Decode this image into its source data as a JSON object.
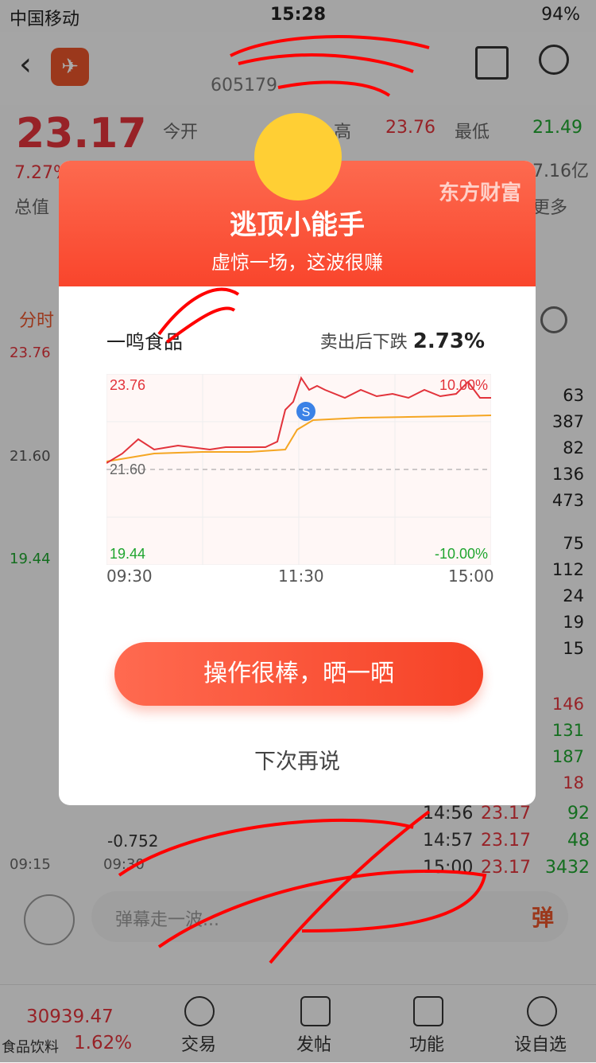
{
  "status": {
    "carrier": "中国移动",
    "time": "15:28",
    "battery": "94%"
  },
  "stock": {
    "code": "605179",
    "price": "23.17",
    "pct": "7.27%",
    "open_label": "今开",
    "high_label": "高",
    "high_value": "23.76",
    "low_label": "最低",
    "low_value": "21.49",
    "amount": "7.16亿",
    "total_label": "总值",
    "more_label": "更多",
    "tab_min": "分时"
  },
  "left_axis": {
    "top": "23.76",
    "mid": "21.60",
    "bottom": "19.44",
    "time1": "09:15",
    "time2": "09:30",
    "neg": "-0.752"
  },
  "side_numbers": [
    "63",
    "387",
    "82",
    "136",
    "473",
    "75",
    "112",
    "24",
    "19",
    "15",
    "146",
    "131",
    "187",
    "18",
    "92",
    "48",
    "3432"
  ],
  "trades": [
    {
      "time": "14:56",
      "price": "23.17",
      "vol": "92"
    },
    {
      "time": "14:57",
      "price": "23.17",
      "vol": "48"
    },
    {
      "time": "15:00",
      "price": "23.17",
      "vol": "3432"
    }
  ],
  "modal": {
    "brand": "东方财富",
    "title": "逃顶小能手",
    "subtitle": "虚惊一场，这波很赚",
    "stock_name": "一鸣食品",
    "drop_label": "卖出后下跌",
    "drop_value": "2.73%",
    "chart_top": "23.76",
    "chart_top_pct": "10.00%",
    "chart_mid": "21.60",
    "chart_bottom": "19.44",
    "chart_bottom_pct": "-10.00%",
    "t1": "09:30",
    "t2": "11:30",
    "t3": "15:00",
    "sell_marker": "S",
    "cta": "操作很棒，晒一晒",
    "later": "下次再说"
  },
  "comment": {
    "placeholder": "弹幕走一波...",
    "danmu_btn": "弹"
  },
  "bottom": {
    "index_value": "30939.47",
    "index_name": "食品饮料",
    "index_pct": "1.62%",
    "tabs": [
      "交易",
      "发帖",
      "功能",
      "设自选"
    ]
  }
}
